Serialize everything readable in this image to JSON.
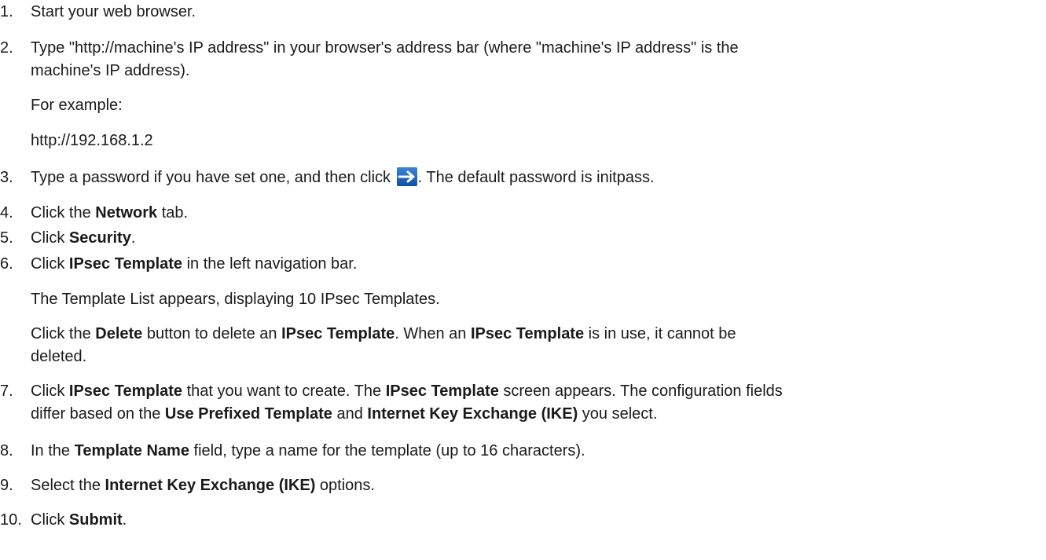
{
  "steps": {
    "s1": {
      "num": "1.",
      "text": "Start your web browser."
    },
    "s2": {
      "num": "2.",
      "line1": "Type \"http://machine's IP address\" in your browser's address bar (where \"machine's IP address\" is the",
      "line2": "machine's IP address).",
      "example_label": "For example:",
      "example_url": "http://192.168.1.2"
    },
    "s3": {
      "num": "3.",
      "before": "Type a password if you have set one, and then click ",
      "after": ". The default password is initpass.",
      "icon": "arrow-right-icon"
    },
    "s4": {
      "num": "4.",
      "a": "Click the ",
      "b": "Network",
      "c": " tab."
    },
    "s5": {
      "num": "5.",
      "a": "Click ",
      "b": "Security",
      "c": "."
    },
    "s6": {
      "num": "6.",
      "a": "Click ",
      "b": "IPsec Template",
      "c": " in the left navigation bar.",
      "list_note": "The Template List appears, displaying 10 IPsec Templates.",
      "d1": "Click the ",
      "d2": "Delete",
      "d3": " button to delete an ",
      "d4": "IPsec Template",
      "d5": ". When an ",
      "d6": "IPsec Template",
      "d7": " is in use, it cannot be",
      "d8": "deleted."
    },
    "s7": {
      "num": "7.",
      "a": "Click ",
      "b": "IPsec Template",
      "c": " that you want to create. The ",
      "d": "IPsec Template",
      "e": " screen appears. The configuration fields",
      "f": "differ based on the ",
      "g": "Use Prefixed Template",
      "h": " and ",
      "i": "Internet Key Exchange (IKE)",
      "j": " you select."
    },
    "s8": {
      "num": "8.",
      "a": "In the ",
      "b": "Template Name",
      "c": " field, type a name for the template (up to 16 characters)."
    },
    "s9": {
      "num": "9.",
      "a": "Select the ",
      "b": "Internet Key Exchange (IKE)",
      "c": " options."
    },
    "s10": {
      "num": "10.",
      "a": "Click ",
      "b": "Submit",
      "c": "."
    }
  }
}
